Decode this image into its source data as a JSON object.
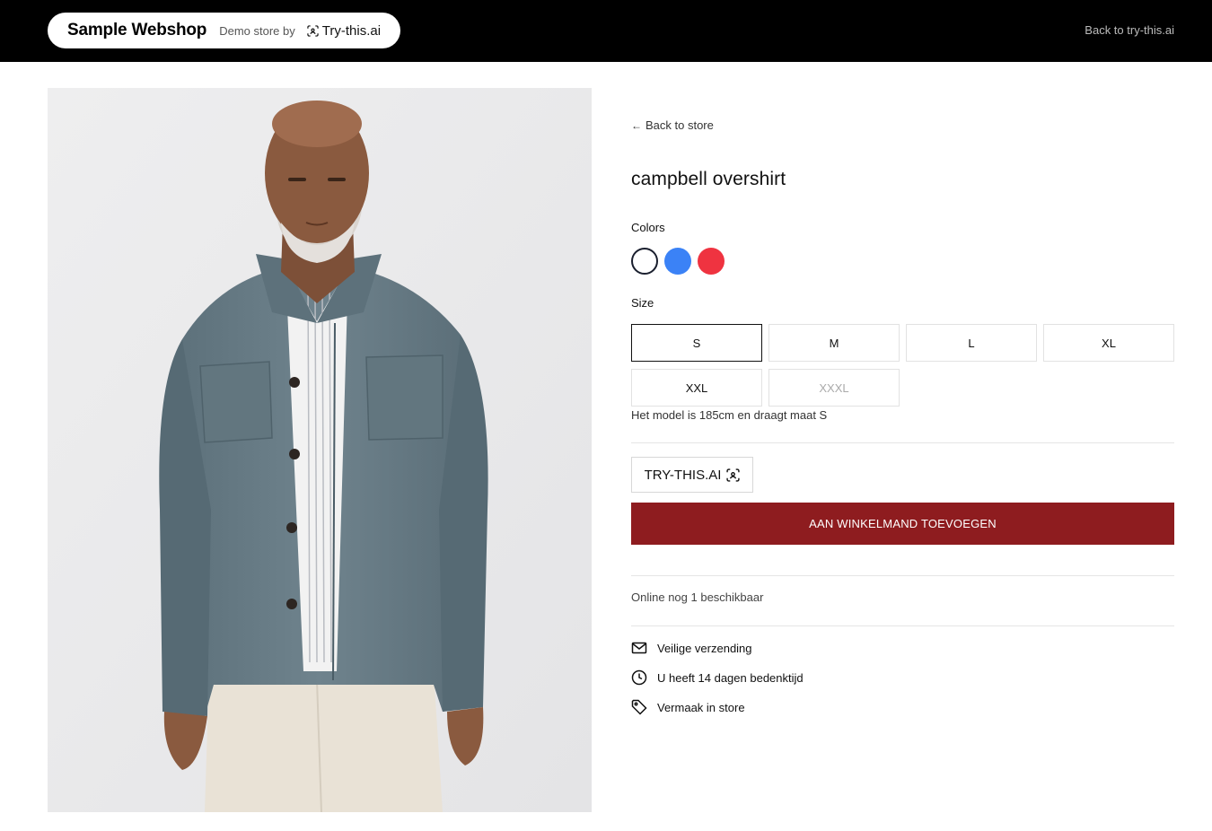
{
  "header": {
    "brand_name": "Sample Webshop",
    "demo_text": "Demo store by",
    "logo_text": "Try-this.ai",
    "back_link": "Back to try-this.ai"
  },
  "product": {
    "back_label": "Back to store",
    "title": "campbell overshirt",
    "colors_label": "Colors",
    "colors": [
      {
        "name": "white",
        "hex": "#ffffff",
        "selected": true
      },
      {
        "name": "blue",
        "hex": "#3b82f6",
        "selected": false
      },
      {
        "name": "red",
        "hex": "#ef3340",
        "selected": false
      }
    ],
    "size_label": "Size",
    "sizes": [
      {
        "label": "S",
        "selected": true,
        "available": true
      },
      {
        "label": "M",
        "selected": false,
        "available": true
      },
      {
        "label": "L",
        "selected": false,
        "available": true
      },
      {
        "label": "XL",
        "selected": false,
        "available": true
      },
      {
        "label": "XXL",
        "selected": false,
        "available": true
      },
      {
        "label": "XXXL",
        "selected": false,
        "available": false
      }
    ],
    "fit_note": "Het model is 185cm en draagt maat S",
    "try_button": "TRY-THIS.AI",
    "cart_button": "AAN WINKELMAND TOEVOEGEN",
    "stock_text": "Online nog 1 beschikbaar",
    "usps": [
      {
        "icon": "mail-icon",
        "text": "Veilige verzending"
      },
      {
        "icon": "clock-icon",
        "text": "U heeft 14 dagen bedenktijd"
      },
      {
        "icon": "tag-icon",
        "text": "Vermaak in store"
      }
    ]
  },
  "colors": {
    "cart_button_bg": "#8e1c1f",
    "topbar_bg": "#000000"
  }
}
